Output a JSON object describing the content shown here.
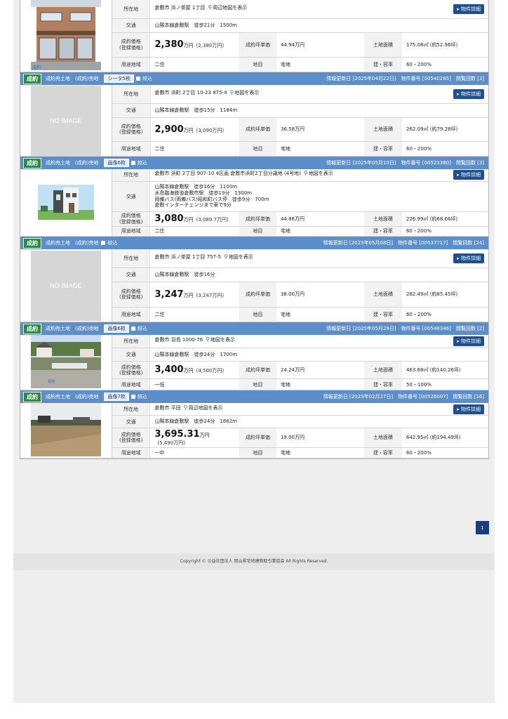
{
  "labels": {
    "location": "所在地",
    "access": "交通",
    "price": "成約価格\n(登録価格)",
    "unit_price": "成約坪単価",
    "land_area": "土地面積",
    "zoning": "用途地域",
    "land_type": "地目",
    "coverage": "建・容率",
    "detail": "物件詳細",
    "status": "成約",
    "filter": "絞込",
    "noimage": "NO IMAGE"
  },
  "listings": [
    {
      "header": null,
      "photo": "house",
      "location": "倉敷市 浜ノ茶屋 1丁目",
      "map_link": "周辺地図を表示",
      "access": [
        "山陽本線倉敷駅　徒歩21分　1500m"
      ],
      "price": "2,380",
      "price_unit": "万円",
      "price_sub": "(2,380万円)",
      "unit_price": "44.94万円",
      "land_area": "175.08㎡ (約52.96坪)",
      "zoning": "二住",
      "land_type": "宅地",
      "coverage": "60・200%"
    },
    {
      "header": {
        "type": "成約売土地　(成約)売地",
        "images": "シータ5枚",
        "updated": "情報更新日 [2025年04月22日]　物件番号 [00540285]　閲覧回数 [3]"
      },
      "photo": "none",
      "location": "倉敷市 浜町 2丁目 10-23 875-4",
      "map_link": "地図を表示",
      "access": [
        "山陽本線倉敷駅　徒歩15分　1184m"
      ],
      "price": "2,900",
      "price_unit": "万円",
      "price_sub": "(3,090万円)",
      "unit_price": "36.58万円",
      "land_area": "262.09㎡ (約79.28坪)",
      "zoning": "二住",
      "land_type": "宅地",
      "coverage": "60・200%"
    },
    {
      "header": {
        "type": "成約売土地　(成約)売地",
        "images": "画像6枚",
        "updated": "情報更新日 [2025年05月10日]　物件番号 [00523380]　閲覧回数 [3]"
      },
      "photo": "modern",
      "location": "倉敷市 浜町 2丁目 907-10 4区画 倉敷市浜町2丁目分譲地 (4号地)",
      "map_link": "地図を表示",
      "access": [
        "山陽本線倉敷駅　徒歩16分　1100m",
        "水島臨海鉄道倉敷市駅　徒歩19分　1300m",
        "両備バス(両備バス)昭和町バス停　徒歩9分　700m",
        "倉敷インターチェンジまで車で9分"
      ],
      "price": "3,080",
      "price_unit": "万円",
      "price_sub": "(3,089.7万円)",
      "unit_price": "44.86万円",
      "land_area": "226.99㎡ (約68.66坪)",
      "zoning": "二住",
      "land_type": "宅地",
      "coverage": "60・200%"
    },
    {
      "header": {
        "type": "成約売土地　(成約)売地",
        "images": "",
        "updated": "情報更新日 [2025年05月08日]　物件番号 [00537717]　閲覧回数 [24]"
      },
      "photo": "none",
      "location": "倉敷市 浜ノ茶屋 1丁目 757-5",
      "map_link": "地図を表示",
      "access": [
        "山陽本線倉敷駅　徒歩16分"
      ],
      "price": "3,247",
      "price_unit": "万円",
      "price_sub": "(3,247万円)",
      "unit_price": "38.00万円",
      "land_area": "282.49㎡ (約85.45坪)",
      "zoning": "二住",
      "land_type": "宅地",
      "coverage": "60・200%"
    },
    {
      "header": {
        "type": "成約売土地　(成約)売地",
        "images": "画像6枚",
        "updated": "情報更新日 [2025年05月29日]　物件番号 [00548346]　閲覧回数 [2]"
      },
      "photo": "lot",
      "location": "倉敷市 羽島 1000-76",
      "map_link": "地図を表示",
      "access": [
        "山陽本線倉敷駅　徒歩24分　1700m"
      ],
      "price": "3,400",
      "price_unit": "万円",
      "price_sub": "(4,500万円)",
      "unit_price": "24.24万円",
      "land_area": "463.68㎡ (約140.26坪)",
      "zoning": "一低",
      "land_type": "宅地",
      "coverage": "50・100%"
    },
    {
      "header": {
        "type": "成約売土地　(成約)売地",
        "images": "画像7枚",
        "updated": "情報更新日 [2025年02月27日]　物件番号 [00526097]　閲覧回数 [16]"
      },
      "photo": "field",
      "location": "倉敷市 平田",
      "map_link": "周辺地図を表示",
      "access": [
        "山陽本線倉敷駅　徒歩24分　1862m"
      ],
      "price": "3,695.31",
      "price_unit": "万円",
      "price_sub": "(5,490万円)",
      "unit_price": "19.00万円",
      "land_area": "642.95㎡ (約194.49坪)",
      "zoning": "一中",
      "land_type": "宅地",
      "coverage": "60・200%"
    }
  ],
  "pager": {
    "current": "1"
  },
  "footer": {
    "copyright": "Copyright © 公益社団法人 岡山県宅地建物取引業協会 All Rights Reserved."
  },
  "colors": {
    "header_bar": "#5c8fc9",
    "status_badge": "#2c8a3e",
    "detail_button": "#1f4f8f"
  }
}
